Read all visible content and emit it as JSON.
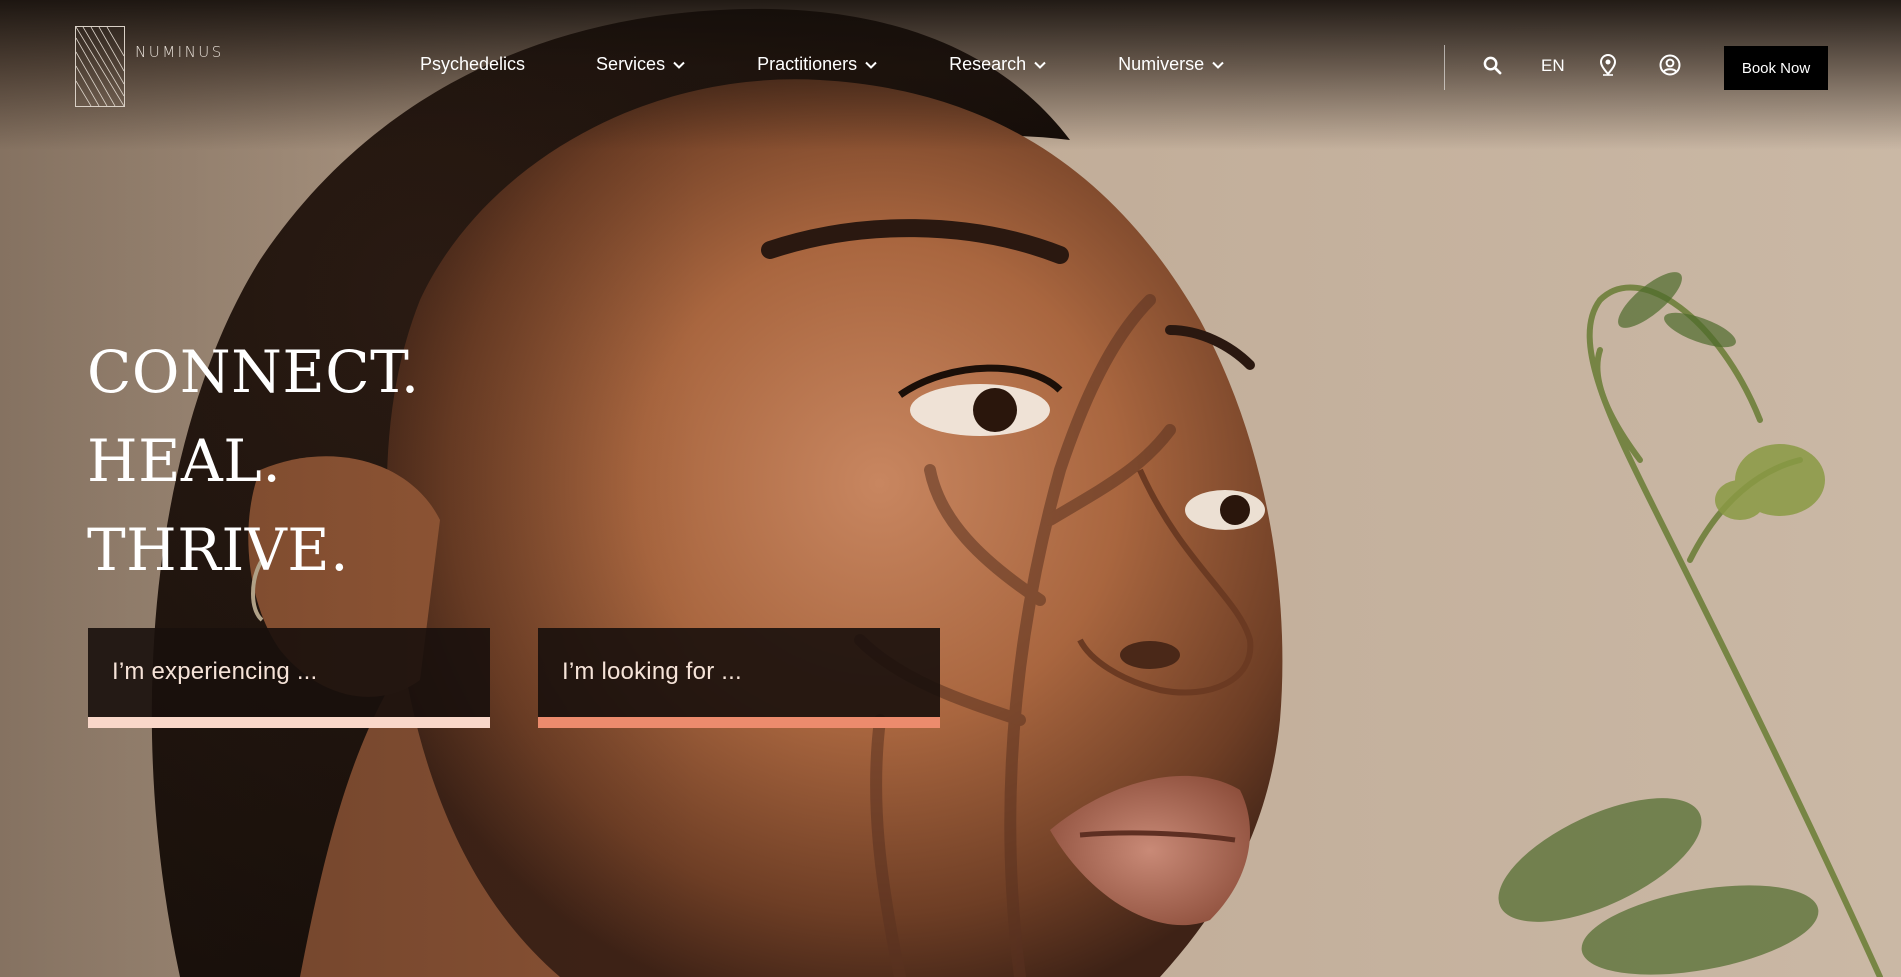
{
  "brand": {
    "name": "NUMINUS"
  },
  "nav": {
    "items": [
      {
        "label": "Psychedelics",
        "has_dropdown": false
      },
      {
        "label": "Services",
        "has_dropdown": true
      },
      {
        "label": "Practitioners",
        "has_dropdown": true
      },
      {
        "label": "Research",
        "has_dropdown": true
      },
      {
        "label": "Numiverse",
        "has_dropdown": true
      }
    ]
  },
  "utility": {
    "search_icon": "search-icon",
    "language": "EN",
    "location_icon": "location-pin-icon",
    "account_icon": "user-account-icon",
    "book_label": "Book Now"
  },
  "hero": {
    "headline": [
      "CONNECT.",
      "HEAL.",
      "THRIVE."
    ],
    "cta_experiencing": "I’m experiencing ...",
    "cta_looking_for": "I’m looking for ..."
  },
  "colors": {
    "book_button_bg": "#000000",
    "cta_bg": "#18100c",
    "cta_experiencing_accent": "#f9d7c9",
    "cta_looking_accent": "#ec8b6d",
    "cta_text": "#f6e3d8"
  }
}
